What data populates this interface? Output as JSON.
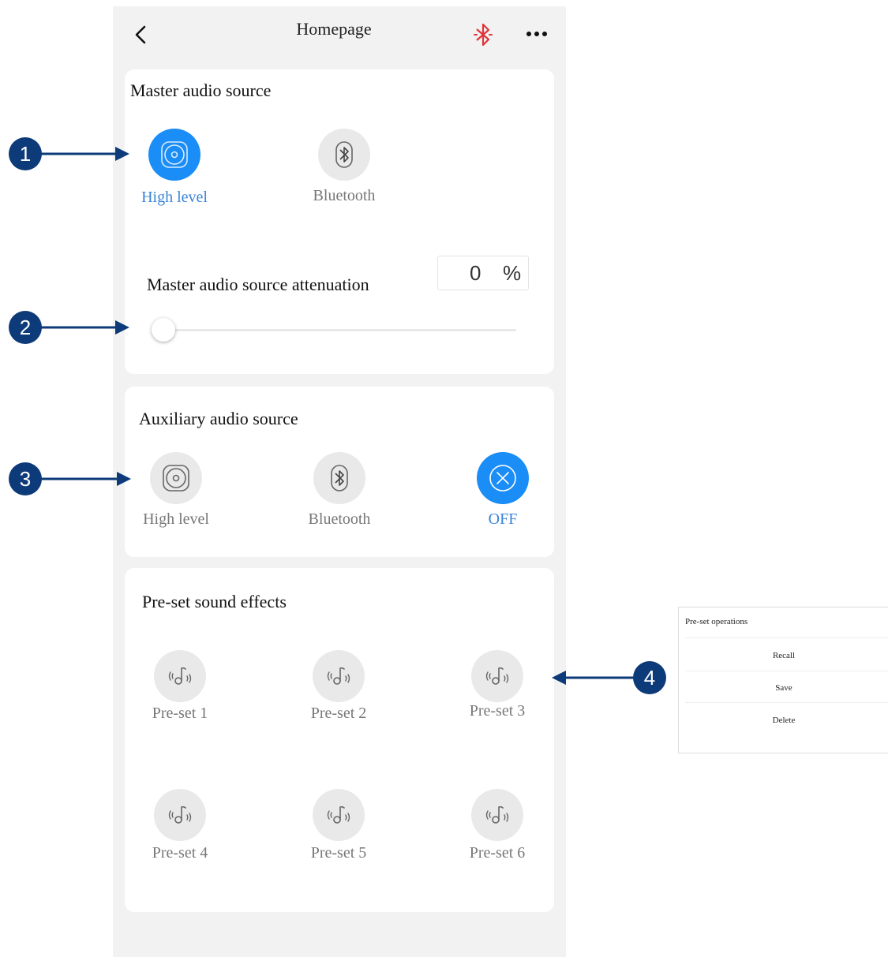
{
  "header": {
    "title": "Homepage",
    "back_icon": "chevron-left-icon",
    "bluetooth_icon": "bluetooth-icon",
    "more_icon": "more-dots-icon",
    "bluetooth_color": "#e0343a"
  },
  "master": {
    "title": "Master audio source",
    "options": [
      {
        "label": "High level",
        "icon": "speaker-icon",
        "active": true
      },
      {
        "label": "Bluetooth",
        "icon": "bluetooth-icon",
        "active": false
      }
    ],
    "attenuation_label": "Master audio source attenuation",
    "attenuation_value": "0",
    "attenuation_unit": "%",
    "attenuation_fraction": 0
  },
  "auxiliary": {
    "title": "Auxiliary audio source",
    "options": [
      {
        "label": "High level",
        "icon": "speaker-icon",
        "active": false
      },
      {
        "label": "Bluetooth",
        "icon": "bluetooth-icon",
        "active": false
      },
      {
        "label": "OFF",
        "icon": "close-circle-icon",
        "active": true
      }
    ]
  },
  "presets": {
    "title": "Pre-set sound effects",
    "items": [
      {
        "label": "Pre-set 1",
        "icon": "music-note-sound-icon"
      },
      {
        "label": "Pre-set 2",
        "icon": "music-note-sound-icon"
      },
      {
        "label": "Pre-set 3",
        "icon": "music-note-sound-icon"
      },
      {
        "label": "Pre-set 4",
        "icon": "music-note-sound-icon"
      },
      {
        "label": "Pre-set 5",
        "icon": "music-note-sound-icon"
      },
      {
        "label": "Pre-set 6",
        "icon": "music-note-sound-icon"
      }
    ]
  },
  "popup": {
    "title": "Pre-set operations",
    "items": [
      "Recall",
      "Save",
      "Delete"
    ]
  },
  "callouts": [
    "1",
    "2",
    "3",
    "4"
  ],
  "colors": {
    "accent": "#1a8df7",
    "accent_text": "#3a84d8",
    "callout": "#0d3a78",
    "page_bg": "#f2f2f2"
  }
}
